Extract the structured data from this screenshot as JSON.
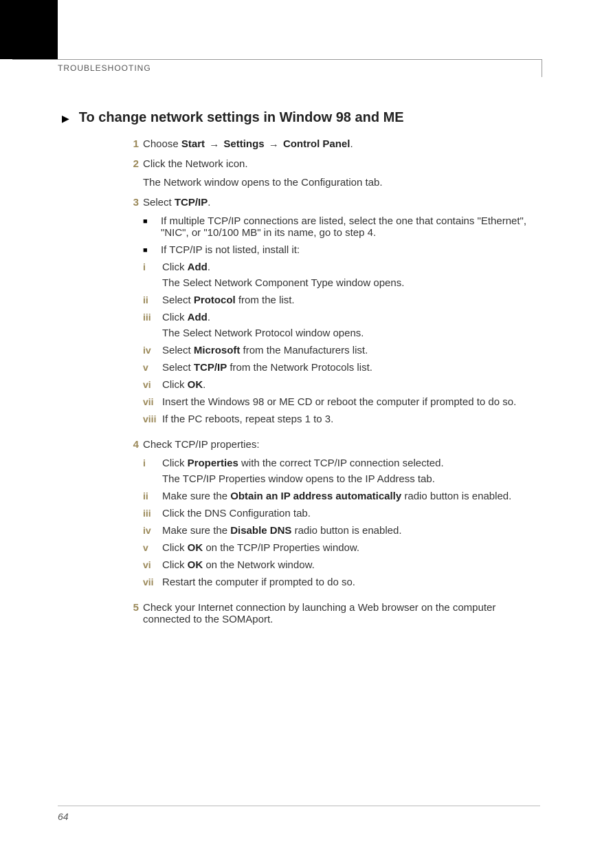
{
  "header": {
    "section": "TROUBLESHOOTING"
  },
  "title": "To change network settings in Window 98 and ME",
  "arrow_glyph": "→",
  "steps": [
    {
      "num": "1",
      "text_pre": "Choose ",
      "b1": "Start",
      "mid1": " ",
      "b2": "Settings",
      "mid2": " ",
      "b3": "Control Panel",
      "text_post": "."
    },
    {
      "num": "2",
      "text": "Click the Network icon.",
      "follow": "The Network window opens to the Configuration tab."
    },
    {
      "num": "3",
      "text_pre": "Select ",
      "b1": "TCP/IP",
      "text_post": ".",
      "bullets": [
        "If multiple TCP/IP connections are listed, select the one that contains \"Ethernet\", \"NIC\", or \"10/100 MB\" in its name, go to step 4.",
        "If TCP/IP is not listed, install it:"
      ],
      "romans": [
        {
          "n": "i",
          "pre": "Click ",
          "b": "Add",
          "post": ".",
          "follow": "The Select Network Component Type window opens."
        },
        {
          "n": "ii",
          "pre": "Select ",
          "b": "Protocol",
          "post": " from the list."
        },
        {
          "n": "iii",
          "pre": "Click ",
          "b": "Add",
          "post": ".",
          "follow": "The Select Network Protocol window opens."
        },
        {
          "n": "iv",
          "pre": "Select ",
          "b": "Microsoft",
          "post": " from the Manufacturers list."
        },
        {
          "n": "v",
          "pre": "Select ",
          "b": "TCP/IP",
          "post": " from the Network Protocols list."
        },
        {
          "n": "vi",
          "pre": "Click ",
          "b": "OK",
          "post": "."
        },
        {
          "n": "vii",
          "text": "Insert the Windows 98 or ME CD or reboot the computer if prompted to do so."
        },
        {
          "n": "viii",
          "text": "If the PC reboots, repeat steps 1 to 3."
        }
      ]
    },
    {
      "num": "4",
      "text": "Check TCP/IP properties:",
      "romans": [
        {
          "n": "i",
          "pre": "Click ",
          "b": "Properties",
          "post": " with the correct TCP/IP connection selected.",
          "follow": "The TCP/IP Properties window opens to the IP Address tab."
        },
        {
          "n": "ii",
          "pre": "Make sure the ",
          "b": "Obtain an IP address automatically",
          "post": " radio button is enabled."
        },
        {
          "n": "iii",
          "text": "Click the DNS Configuration tab."
        },
        {
          "n": "iv",
          "pre": "Make sure the ",
          "b": "Disable DNS",
          "post": " radio button is enabled."
        },
        {
          "n": "v",
          "pre": "Click ",
          "b": "OK",
          "post": " on the TCP/IP Properties window."
        },
        {
          "n": "vi",
          "pre": "Click ",
          "b": "OK",
          "post": " on the Network window."
        },
        {
          "n": "vii",
          "text": "Restart the computer if prompted to do so."
        }
      ]
    },
    {
      "num": "5",
      "text": "Check your Internet connection by launching a Web browser on the computer connected to the SOMAport."
    }
  ],
  "page_number": "64"
}
